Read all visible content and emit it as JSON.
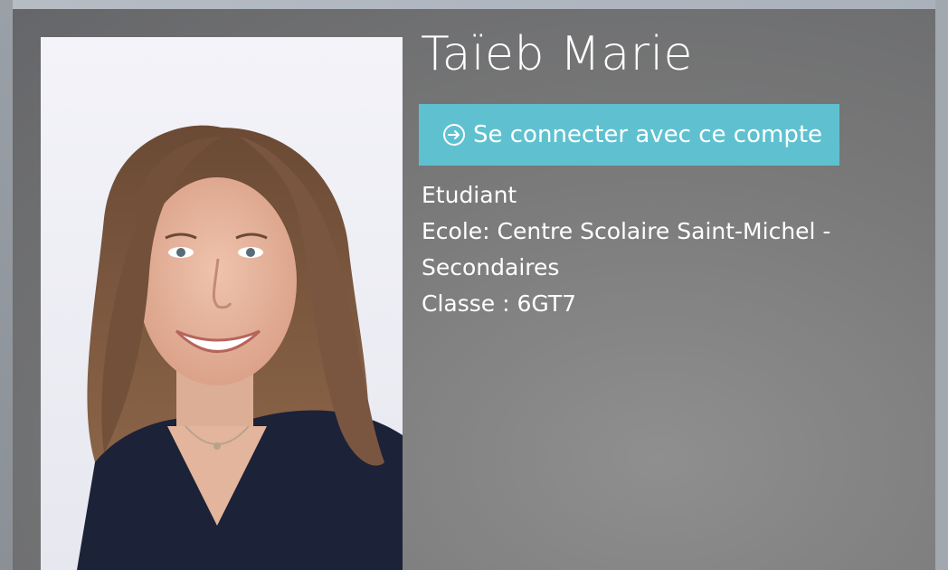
{
  "profile": {
    "name": "Taïeb Marie",
    "login_button_label": "Se connecter avec ce compte",
    "login_icon": "arrow-right-circle-icon",
    "role": "Etudiant",
    "school_line1": "Ecole: Centre Scolaire Saint-Michel -",
    "school_line2": "Secondaires",
    "class_line": "Classe : 6GT7"
  },
  "colors": {
    "button_bg": "#5fc1d0",
    "text": "#ffffff",
    "card_bg": "#6f7073"
  }
}
